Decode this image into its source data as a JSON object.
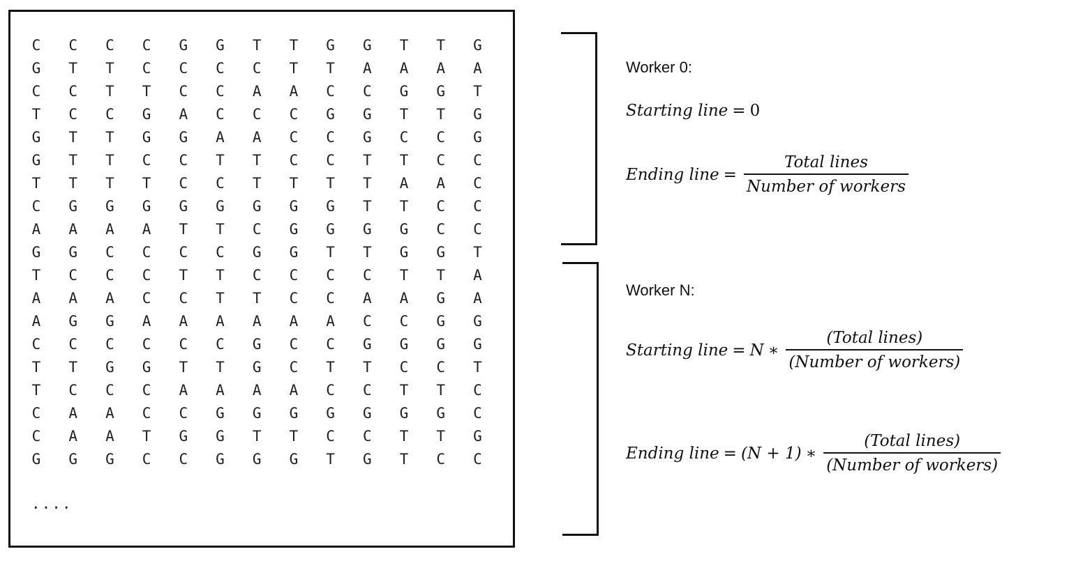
{
  "sequence": {
    "rows": [
      [
        "C",
        "C",
        "C",
        "C",
        "G",
        "G",
        "T",
        "T",
        "G",
        "G",
        "T",
        "T",
        "G"
      ],
      [
        "G",
        "T",
        "T",
        "C",
        "C",
        "C",
        "C",
        "T",
        "T",
        "A",
        "A",
        "A",
        "A"
      ],
      [
        "C",
        "C",
        "T",
        "T",
        "C",
        "C",
        "A",
        "A",
        "C",
        "C",
        "G",
        "G",
        "T"
      ],
      [
        "T",
        "C",
        "C",
        "G",
        "A",
        "C",
        "C",
        "C",
        "G",
        "G",
        "T",
        "T",
        "G"
      ],
      [
        "G",
        "T",
        "T",
        "G",
        "G",
        "A",
        "A",
        "C",
        "C",
        "G",
        "C",
        "C",
        "G"
      ],
      [
        "G",
        "T",
        "T",
        "C",
        "C",
        "T",
        "T",
        "C",
        "C",
        "T",
        "T",
        "C",
        "C"
      ],
      [
        "T",
        "T",
        "T",
        "T",
        "C",
        "C",
        "T",
        "T",
        "T",
        "T",
        "A",
        "A",
        "C"
      ],
      [
        "C",
        "G",
        "G",
        "G",
        "G",
        "G",
        "G",
        "G",
        "G",
        "T",
        "T",
        "C",
        "C"
      ],
      [
        "A",
        "A",
        "A",
        "A",
        "T",
        "T",
        "C",
        "G",
        "G",
        "G",
        "G",
        "C",
        "C"
      ],
      [
        "G",
        "G",
        "C",
        "C",
        "C",
        "C",
        "G",
        "G",
        "T",
        "T",
        "G",
        "G",
        "T"
      ],
      [
        "T",
        "C",
        "C",
        "C",
        "T",
        "T",
        "C",
        "C",
        "C",
        "C",
        "T",
        "T",
        "A"
      ],
      [
        "A",
        "A",
        "A",
        "C",
        "C",
        "T",
        "T",
        "C",
        "C",
        "A",
        "A",
        "G",
        "A"
      ],
      [
        "A",
        "G",
        "G",
        "A",
        "A",
        "A",
        "A",
        "A",
        "A",
        "C",
        "C",
        "G",
        "G"
      ],
      [
        "C",
        "C",
        "C",
        "C",
        "C",
        "C",
        "G",
        "C",
        "C",
        "G",
        "G",
        "G",
        "G"
      ],
      [
        "T",
        "T",
        "G",
        "G",
        "T",
        "T",
        "G",
        "C",
        "T",
        "T",
        "C",
        "C",
        "T"
      ],
      [
        "T",
        "C",
        "C",
        "C",
        "A",
        "A",
        "A",
        "A",
        "C",
        "C",
        "T",
        "T",
        "C"
      ],
      [
        "C",
        "A",
        "A",
        "C",
        "C",
        "G",
        "G",
        "G",
        "G",
        "G",
        "G",
        "G",
        "C"
      ],
      [
        "C",
        "A",
        "A",
        "T",
        "G",
        "G",
        "T",
        "T",
        "C",
        "C",
        "T",
        "T",
        "G"
      ],
      [
        "G",
        "G",
        "G",
        "C",
        "C",
        "G",
        "G",
        "G",
        "T",
        "G",
        "T",
        "C",
        "C"
      ]
    ],
    "ellipsis": "...."
  },
  "worker0": {
    "title": "Worker 0:",
    "starting_label": "Starting line",
    "starting_value": "0",
    "ending_label": "Ending line",
    "ending_num": "Total lines",
    "ending_den": "Number of workers"
  },
  "workerN": {
    "title": "Worker N:",
    "starting_label": "Starting line",
    "starting_factor": "N",
    "starting_num": "(Total lines)",
    "starting_den": "(Number of workers)",
    "ending_label": "Ending line",
    "ending_factor": "(N + 1)",
    "ending_num": "(Total lines)",
    "ending_den": "(Number of workers)"
  },
  "symbols": {
    "equals": "=",
    "times": "∗"
  }
}
